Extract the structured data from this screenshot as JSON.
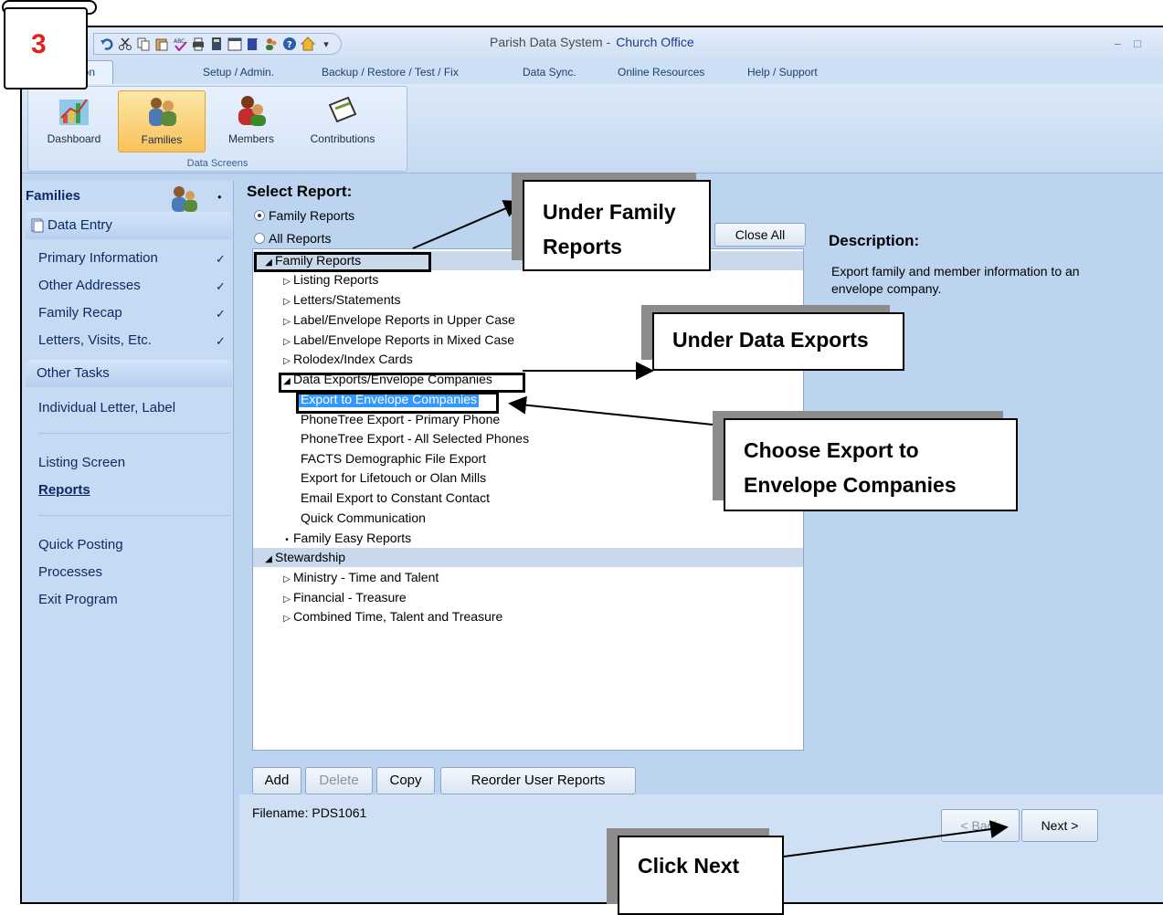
{
  "window": {
    "title": "Parish Data System -",
    "office": "Church Office"
  },
  "tabs": [
    "Information",
    "Setup / Admin.",
    "Backup / Restore / Test / Fix",
    "Data Sync.",
    "Online Resources",
    "Help / Support"
  ],
  "ribbon": {
    "buttons": [
      "Dashboard",
      "Families",
      "Members",
      "Contributions"
    ],
    "group": "Data Screens"
  },
  "sidebar": {
    "heading": "Families",
    "data_entry": "Data Entry",
    "items": [
      "Primary Information",
      "Other Addresses",
      "Family Recap",
      "Letters, Visits, Etc."
    ],
    "check": "✓",
    "other_tasks": "Other Tasks",
    "tasks": [
      "Individual Letter, Label",
      "Listing Screen",
      "Reports",
      "Quick Posting",
      "Processes",
      "Exit Program"
    ]
  },
  "main": {
    "title": "Select Report:",
    "radio_family": "Family Reports",
    "radio_all": "All Reports",
    "close_all": "Close All",
    "description_title": "Description:",
    "description_text": "Export family and member information to an envelope company.",
    "filename": "Filename: PDS1061"
  },
  "tree": [
    "Family Reports",
    "Listing Reports",
    "Letters/Statements",
    "Label/Envelope Reports in Upper Case",
    "Label/Envelope Reports in Mixed Case",
    "Rolodex/Index Cards",
    "Data Exports/Envelope Companies",
    "Export to Envelope Companies",
    "PhoneTree Export - Primary Phone",
    "PhoneTree Export - All Selected Phones",
    "FACTS Demographic File Export",
    "Export for Lifetouch or Olan Mills",
    "Email Export to Constant Contact",
    "Quick Communication",
    "Family Easy Reports",
    "Stewardship",
    "Ministry - Time and Talent",
    "Financial - Treasure",
    "Combined Time, Talent and Treasure"
  ],
  "buttons": {
    "add": "Add",
    "delete": "Delete",
    "copy": "Copy",
    "reorder": "Reorder User Reports",
    "back": "< Back",
    "next": "Next >"
  },
  "annotations": {
    "step": "3",
    "family": [
      "Under Family",
      "Reports"
    ],
    "data_exports": "Under Data Exports",
    "choose": [
      "Choose Export to",
      "Envelope Companies"
    ],
    "click_next": "Click Next"
  },
  "colors": {
    "selection": "#3399ff",
    "step_number": "#e0241d",
    "window_bg": "#bcd4ef"
  }
}
